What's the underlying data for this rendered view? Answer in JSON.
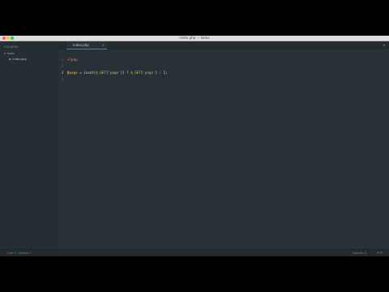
{
  "window": {
    "title": "index.php — kodui"
  },
  "sidebar": {
    "heading": "FOLDERS",
    "folder": {
      "label": "kodui"
    },
    "file": {
      "label": "index.php"
    }
  },
  "tabs": [
    {
      "label": "index.php",
      "close": "×"
    }
  ],
  "tab_overflow": "▾",
  "editor": {
    "lines": [
      {
        "number": "1",
        "active": false,
        "tokens": [
          {
            "text": "<?php",
            "kind": "tag"
          }
        ]
      },
      {
        "number": "2",
        "active": false,
        "tokens": []
      },
      {
        "number": "3",
        "active": true,
        "tokens": [
          {
            "text": "$page",
            "kind": "var"
          },
          {
            "text": " = ",
            "kind": "op"
          },
          {
            "text": "isset(",
            "kind": "plain"
          },
          {
            "text": "$_GET",
            "kind": "var"
          },
          {
            "text": "[",
            "kind": "plain"
          },
          {
            "text": "'page'",
            "kind": "str"
          },
          {
            "text": "]) ? ",
            "kind": "plain"
          },
          {
            "text": "$_GET",
            "kind": "var"
          },
          {
            "text": "[",
            "kind": "plain"
          },
          {
            "text": "'page'",
            "kind": "str"
          },
          {
            "text": "] : 1;",
            "kind": "plain"
          }
        ]
      },
      {
        "number": "4",
        "active": false,
        "tokens": []
      }
    ]
  },
  "status": {
    "left": "Line 3, Column 1",
    "indent": "Spaces: 4",
    "syntax": "PHP"
  },
  "colors": {
    "background": "#283236",
    "sidebar": "#252e32",
    "accent": "#5d7b8a"
  }
}
